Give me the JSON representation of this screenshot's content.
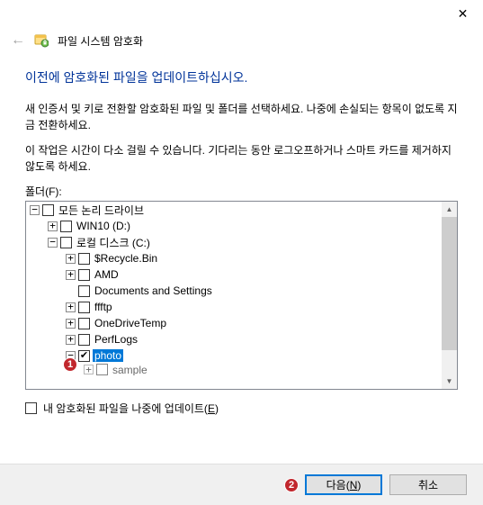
{
  "titlebar": {
    "close_glyph": "✕"
  },
  "header": {
    "back_glyph": "←",
    "title": "파일 시스템 암호화"
  },
  "heading": "이전에 암호화된 파일을 업데이트하십시오.",
  "para1": "새 인증서 및 키로 전환할 암호화된 파일 및 폴더를 선택하세요. 나중에 손실되는 항목이 없도록 지금 전환하세요.",
  "para2": "이 작업은 시간이 다소 걸릴 수 있습니다. 기다리는 동안 로그오프하거나 스마트 카드를 제거하지 않도록 하세요.",
  "folders_label": "폴더(F):",
  "tree": {
    "root": {
      "label": "모든 논리 드라이브",
      "expander": "−",
      "checked": false,
      "indent": 4
    },
    "items": [
      {
        "label": "WIN10 (D:)",
        "expander": "+",
        "checked": false,
        "indent": 24
      },
      {
        "label": "로컬 디스크 (C:)",
        "expander": "−",
        "checked": false,
        "indent": 24
      },
      {
        "label": "$Recycle.Bin",
        "expander": "+",
        "checked": false,
        "indent": 44
      },
      {
        "label": "AMD",
        "expander": "+",
        "checked": false,
        "indent": 44
      },
      {
        "label": "Documents and Settings",
        "expander": "",
        "checked": false,
        "indent": 44
      },
      {
        "label": "ffftp",
        "expander": "+",
        "checked": false,
        "indent": 44
      },
      {
        "label": "OneDriveTemp",
        "expander": "+",
        "checked": false,
        "indent": 44
      },
      {
        "label": "PerfLogs",
        "expander": "+",
        "checked": false,
        "indent": 44
      },
      {
        "label": "photo",
        "expander": "−",
        "checked": true,
        "indent": 44,
        "selected": true
      },
      {
        "label": "sample",
        "expander": "+",
        "checked": false,
        "indent": 64,
        "cut": true
      }
    ]
  },
  "later_checkbox": {
    "checked": false,
    "label_pre": "내 암호화된 파일을 나중에 업데이트(",
    "label_hotkey": "E",
    "label_post": ")"
  },
  "buttons": {
    "next_pre": "다음(",
    "next_hotkey": "N",
    "next_post": ")",
    "cancel": "취소"
  },
  "markers": {
    "one": "1",
    "two": "2"
  },
  "colors": {
    "accent": "#0078d7",
    "heading": "#003399",
    "badge": "#C1272D"
  }
}
